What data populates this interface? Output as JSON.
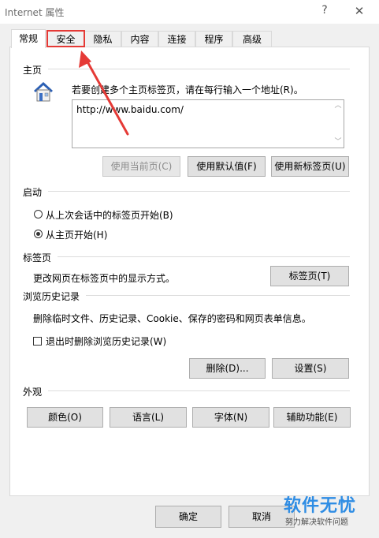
{
  "window": {
    "title": "Internet 属性",
    "help": "?",
    "close": "✕"
  },
  "tabs": [
    {
      "label": "常规"
    },
    {
      "label": "安全"
    },
    {
      "label": "隐私"
    },
    {
      "label": "内容"
    },
    {
      "label": "连接"
    },
    {
      "label": "程序"
    },
    {
      "label": "高级"
    }
  ],
  "homepage": {
    "section": "主页",
    "icon": "house-icon",
    "hint": "若要创建多个主页标签页，请在每行输入一个地址(R)。",
    "url": "http://www.baidu.com/",
    "buttons": {
      "current": "使用当前页(C)",
      "default": "使用默认值(F)",
      "newtab": "使用新标签页(U)"
    }
  },
  "startup": {
    "section": "启动",
    "options": [
      {
        "label": "从上次会话中的标签页开始(B)",
        "selected": false
      },
      {
        "label": "从主页开始(H)",
        "selected": true
      }
    ]
  },
  "tabs_section": {
    "section": "标签页",
    "desc": "更改网页在标签页中的显示方式。",
    "button": "标签页(T)"
  },
  "history": {
    "section": "浏览历史记录",
    "desc": "删除临时文件、历史记录、Cookie、保存的密码和网页表单信息。",
    "checkbox": "退出时删除浏览历史记录(W)",
    "delete": "删除(D)...",
    "settings": "设置(S)"
  },
  "appearance": {
    "section": "外观",
    "buttons": {
      "colors": "颜色(O)",
      "languages": "语言(L)",
      "fonts": "字体(N)",
      "accessibility": "辅助功能(E)"
    }
  },
  "footer": {
    "ok": "确定",
    "cancel": "取消"
  },
  "watermark": {
    "title": "软件无忧",
    "subtitle": "努力解决软件问题"
  },
  "colors": {
    "highlight": "#e53a36",
    "watermark": "#2f8de4"
  }
}
